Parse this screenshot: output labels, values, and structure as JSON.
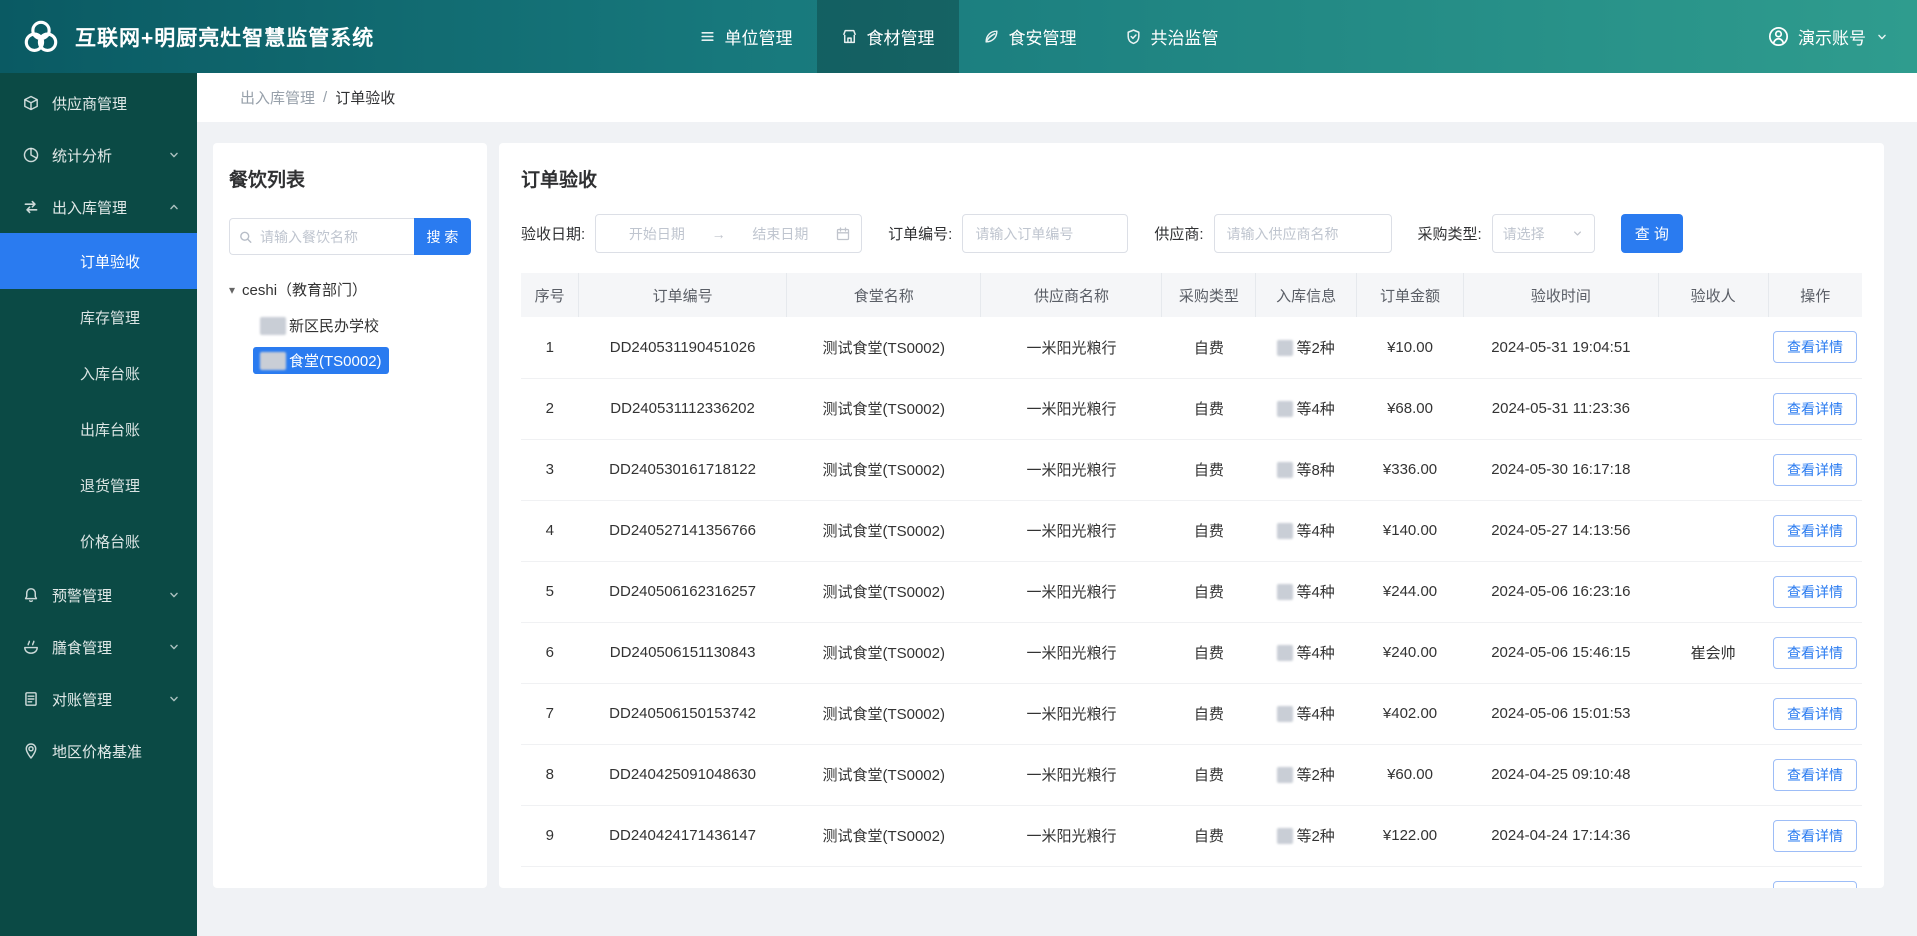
{
  "header": {
    "title": "互联网+明厨亮灶智慧监管系统",
    "nav": [
      {
        "label": "单位管理",
        "active": false
      },
      {
        "label": "食材管理",
        "active": true
      },
      {
        "label": "食安管理",
        "active": false
      },
      {
        "label": "共治监管",
        "active": false
      }
    ],
    "user": {
      "name": "演示账号"
    }
  },
  "sidebar": {
    "items": [
      {
        "label": "供应商管理"
      },
      {
        "label": "统计分析",
        "expandable": true,
        "expanded": false
      },
      {
        "label": "出入库管理",
        "expandable": true,
        "expanded": true,
        "children": [
          {
            "label": "订单验收",
            "active": true
          },
          {
            "label": "库存管理"
          },
          {
            "label": "入库台账"
          },
          {
            "label": "出库台账"
          },
          {
            "label": "退货管理"
          },
          {
            "label": "价格台账"
          }
        ]
      },
      {
        "label": "预警管理",
        "expandable": true,
        "expanded": false
      },
      {
        "label": "膳食管理",
        "expandable": true,
        "expanded": false
      },
      {
        "label": "对账管理",
        "expandable": true,
        "expanded": false
      },
      {
        "label": "地区价格基准"
      }
    ]
  },
  "breadcrumb": {
    "parent": "出入库管理",
    "separator": "/",
    "current": "订单验收"
  },
  "restaurant_panel": {
    "title": "餐饮列表",
    "search_placeholder": "请输入餐饮名称",
    "search_button": "搜 索",
    "tree": {
      "root": "ceshi（教育部门）",
      "children": [
        {
          "label": "新区民办学校",
          "selected": false
        },
        {
          "label": "食堂(TS0002)",
          "selected": true
        }
      ]
    }
  },
  "orders_panel": {
    "title": "订单验收",
    "filters": {
      "date_label": "验收日期:",
      "date_start_placeholder": "开始日期",
      "date_arrow": "→",
      "date_end_placeholder": "结束日期",
      "order_no_label": "订单编号:",
      "order_no_placeholder": "请输入订单编号",
      "supplier_label": "供应商:",
      "supplier_placeholder": "请输入供应商名称",
      "type_label": "采购类型:",
      "type_placeholder": "请选择",
      "query_button": "查 询"
    },
    "table": {
      "columns": [
        "序号",
        "订单编号",
        "食堂名称",
        "供应商名称",
        "采购类型",
        "入库信息",
        "订单金额",
        "验收时间",
        "验收人",
        "操作"
      ],
      "action_label": "查看详情",
      "rows": [
        {
          "no": "1",
          "order_no": "DD240531190451026",
          "canteen": "测试食堂(TS0002)",
          "supplier": "一米阳光粮行",
          "type": "自费",
          "stock_info": "等2种",
          "amount": "¥10.00",
          "time": "2024-05-31 19:04:51",
          "acceptor": ""
        },
        {
          "no": "2",
          "order_no": "DD240531112336202",
          "canteen": "测试食堂(TS0002)",
          "supplier": "一米阳光粮行",
          "type": "自费",
          "stock_info": "等4种",
          "amount": "¥68.00",
          "time": "2024-05-31 11:23:36",
          "acceptor": ""
        },
        {
          "no": "3",
          "order_no": "DD240530161718122",
          "canteen": "测试食堂(TS0002)",
          "supplier": "一米阳光粮行",
          "type": "自费",
          "stock_info": "等8种",
          "amount": "¥336.00",
          "time": "2024-05-30 16:17:18",
          "acceptor": ""
        },
        {
          "no": "4",
          "order_no": "DD240527141356766",
          "canteen": "测试食堂(TS0002)",
          "supplier": "一米阳光粮行",
          "type": "自费",
          "stock_info": "等4种",
          "amount": "¥140.00",
          "time": "2024-05-27 14:13:56",
          "acceptor": ""
        },
        {
          "no": "5",
          "order_no": "DD240506162316257",
          "canteen": "测试食堂(TS0002)",
          "supplier": "一米阳光粮行",
          "type": "自费",
          "stock_info": "等4种",
          "amount": "¥244.00",
          "time": "2024-05-06 16:23:16",
          "acceptor": ""
        },
        {
          "no": "6",
          "order_no": "DD240506151130843",
          "canteen": "测试食堂(TS0002)",
          "supplier": "一米阳光粮行",
          "type": "自费",
          "stock_info": "等4种",
          "amount": "¥240.00",
          "time": "2024-05-06 15:46:15",
          "acceptor": "崔会帅"
        },
        {
          "no": "7",
          "order_no": "DD240506150153742",
          "canteen": "测试食堂(TS0002)",
          "supplier": "一米阳光粮行",
          "type": "自费",
          "stock_info": "等4种",
          "amount": "¥402.00",
          "time": "2024-05-06 15:01:53",
          "acceptor": ""
        },
        {
          "no": "8",
          "order_no": "DD240425091048630",
          "canteen": "测试食堂(TS0002)",
          "supplier": "一米阳光粮行",
          "type": "自费",
          "stock_info": "等2种",
          "amount": "¥60.00",
          "time": "2024-04-25 09:10:48",
          "acceptor": ""
        },
        {
          "no": "9",
          "order_no": "DD240424171436147",
          "canteen": "测试食堂(TS0002)",
          "supplier": "一米阳光粮行",
          "type": "自费",
          "stock_info": "等2种",
          "amount": "¥122.00",
          "time": "2024-04-24 17:14:36",
          "acceptor": ""
        },
        {
          "no": "",
          "order_no": "",
          "canteen": "",
          "supplier": "",
          "type": "",
          "stock_info": "",
          "amount": "",
          "time": "",
          "acceptor": "",
          "partial": true
        }
      ]
    }
  },
  "colors": {
    "accent_blue": "#2a7bf0",
    "header_teal": "#2f9c8e",
    "sidebar_green": "#0b4a45",
    "page_background": "#f0f2f5"
  }
}
